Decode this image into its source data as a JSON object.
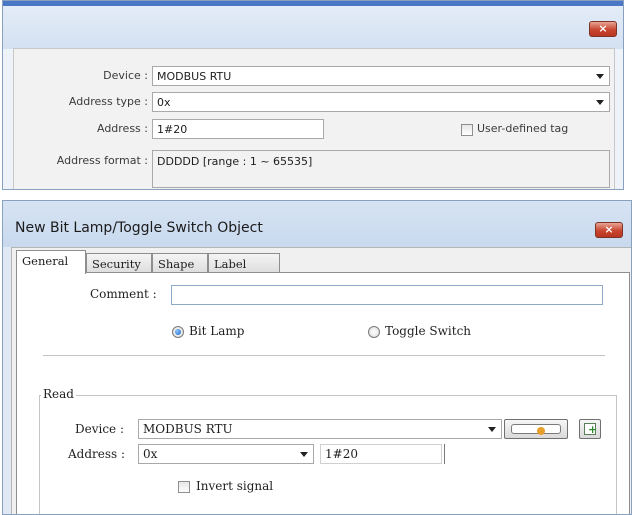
{
  "panel1": {
    "close_label": "×",
    "device_label": "Device :",
    "device_value": "MODBUS RTU",
    "address_type_label": "Address type :",
    "address_type_value": "0x",
    "address_label": "Address :",
    "address_value": "1#20",
    "user_defined_tag_label": "User-defined tag",
    "address_format_label": "Address format :",
    "address_format_value": "DDDDD [range : 1 ~ 65535]"
  },
  "panel2": {
    "title": "New Bit Lamp/Toggle Switch Object",
    "close_label": "×",
    "tabs": [
      {
        "label": "General"
      },
      {
        "label": "Security"
      },
      {
        "label": "Shape"
      },
      {
        "label": "Label"
      }
    ],
    "comment_label": "Comment :",
    "comment_value": "",
    "mode_options": [
      {
        "label": "Bit Lamp",
        "selected": true
      },
      {
        "label": "Toggle Switch",
        "selected": false
      }
    ],
    "read_group": {
      "title": "Read",
      "device_label": "Device :",
      "device_value": "MODBUS RTU",
      "address_label": "Address :",
      "address_type_value": "0x",
      "address_value": "1#20",
      "invert_signal_label": "Invert signal",
      "invert_signal_checked": false
    }
  }
}
